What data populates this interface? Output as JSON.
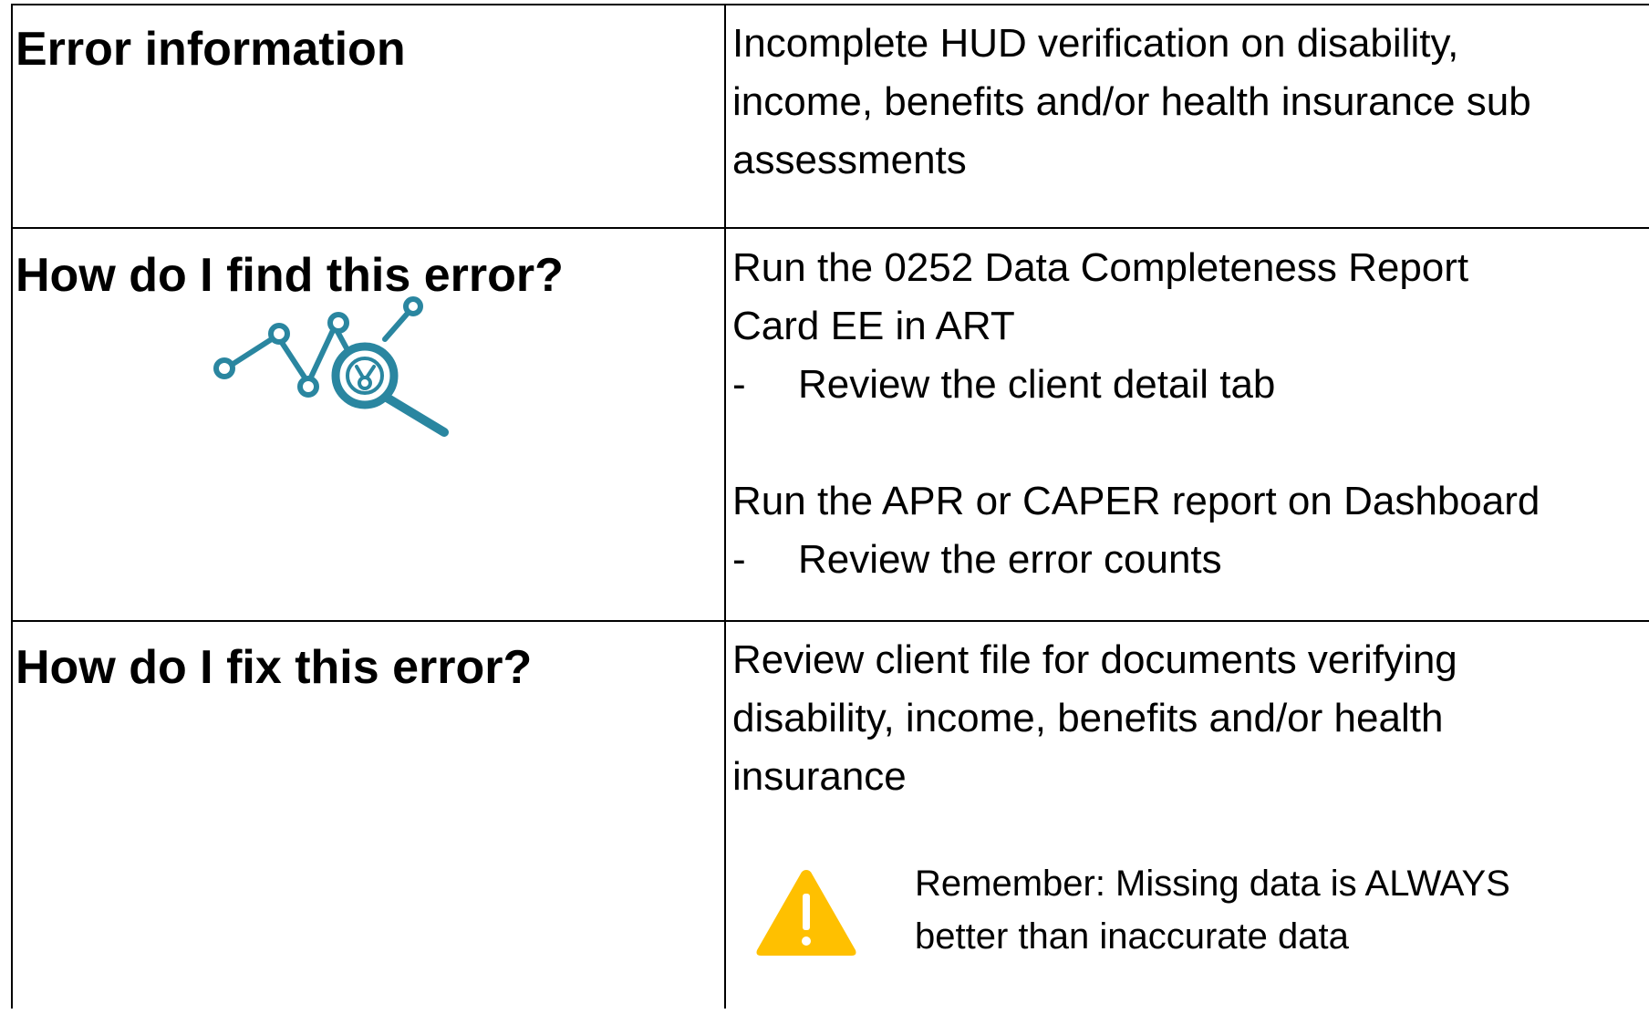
{
  "rows": [
    {
      "label": "Error information",
      "content": [
        "Incomplete HUD verification on disability,",
        "income, benefits and/or health insurance sub",
        "assessments"
      ]
    },
    {
      "label": "How do I find this error?",
      "block1_lines": [
        "Run the 0252 Data Completeness Report",
        "Card EE in ART"
      ],
      "block1_bullet": "Review the client detail tab",
      "block2_line": "Run the APR or CAPER report on Dashboard",
      "block2_bullet": "Review the error counts",
      "bullet_marker": "-",
      "icon": "analytics-search-icon"
    },
    {
      "label": "How do I fix this error?",
      "content": [
        "Review client file for documents verifying",
        "disability, income, benefits and/or health",
        "insurance"
      ],
      "reminder": [
        "Remember: Missing data is ALWAYS",
        "better than inaccurate data"
      ],
      "icon": "warning-icon"
    }
  ],
  "colors": {
    "icon_teal": "#2a86a0",
    "warning_yellow": "#ffc000"
  }
}
